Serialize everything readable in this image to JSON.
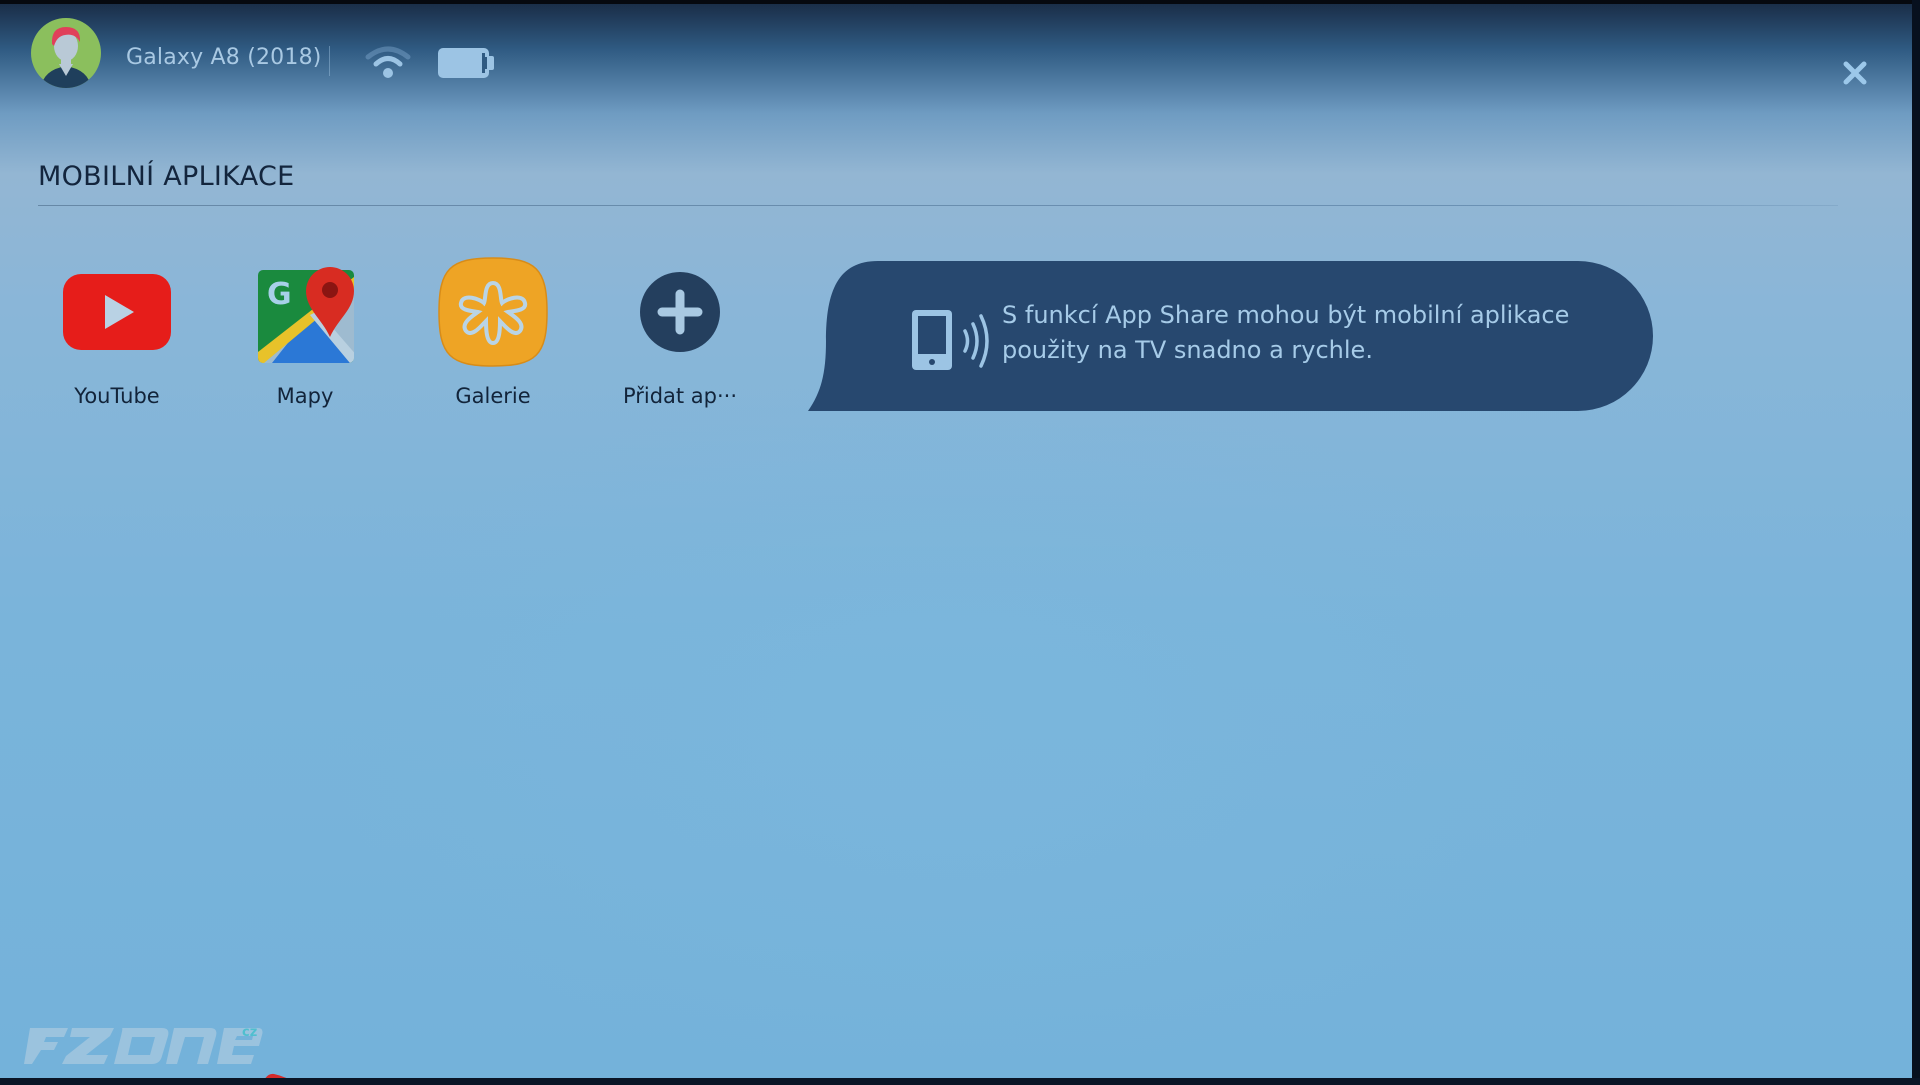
{
  "header": {
    "device_name": "Galaxy A8 (2018)",
    "avatar_icon": "user-avatar-icon",
    "wifi_icon": "wifi-icon",
    "battery_icon": "battery-icon",
    "close_icon": "close-icon"
  },
  "section": {
    "title": "MOBILNÍ APLIKACE"
  },
  "apps": [
    {
      "label": "YouTube",
      "icon": "youtube-icon",
      "color": "#e62117"
    },
    {
      "label": "Mapy",
      "icon": "google-maps-icon",
      "color": "#34a853"
    },
    {
      "label": "Galerie",
      "icon": "gallery-icon",
      "color": "#eea425"
    },
    {
      "label": "Přidat ap···",
      "icon": "add-icon",
      "color": "#243f5e"
    }
  ],
  "info_bubble": {
    "icon": "phone-share-icon",
    "text": "S funkcí App Share mohou být mobilní aplikace použity na TV snadno a rychle.",
    "color": "#27486f"
  },
  "watermark": {
    "text": "FZONE",
    "suffix": "cz"
  },
  "colors": {
    "background": "#7ab4da",
    "text_dark": "#12243a",
    "text_light": "#a6cbe8"
  }
}
